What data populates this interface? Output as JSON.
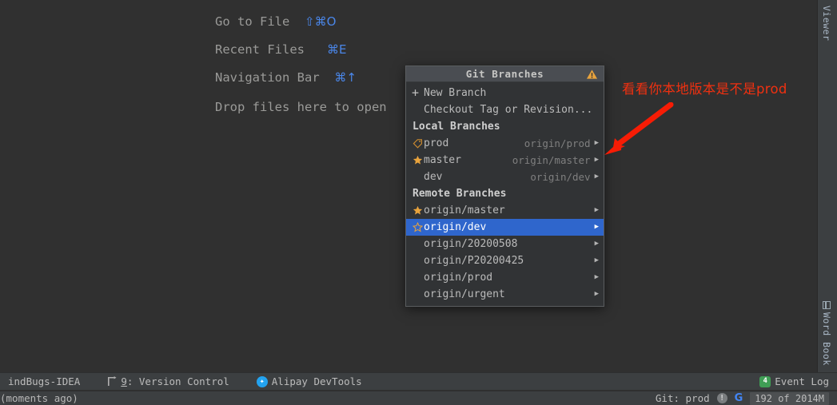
{
  "editor_hints": [
    {
      "label": "Go to File",
      "shortcut": "⇧⌘O"
    },
    {
      "label": "Recent Files",
      "shortcut": "⌘E"
    },
    {
      "label": "Navigation Bar",
      "shortcut": "⌘↑"
    },
    {
      "label": "Drop files here to open",
      "shortcut": ""
    }
  ],
  "right_strip": {
    "tabs": [
      {
        "label": "N Viewer",
        "icon": "json-viewer-icon"
      },
      {
        "label": "Word Book",
        "icon": "book-icon"
      }
    ]
  },
  "popup": {
    "title": "Git Branches",
    "warning_icon": "warning-triangle-icon",
    "actions": [
      {
        "label": "New Branch",
        "icon": "plus-icon"
      },
      {
        "label": "Checkout Tag or Revision...",
        "icon": ""
      }
    ],
    "local_section": "Local Branches",
    "local_branches": [
      {
        "name": "prod",
        "tracking": "origin/prod",
        "icon": "tag-icon",
        "selected": false,
        "arrow": "▶"
      },
      {
        "name": "master",
        "tracking": "origin/master",
        "icon": "star-filled-icon",
        "selected": false,
        "arrow": "▶"
      },
      {
        "name": "dev",
        "tracking": "origin/dev",
        "icon": "",
        "selected": false,
        "arrow": "▶"
      }
    ],
    "remote_section": "Remote Branches",
    "remote_branches": [
      {
        "name": "origin/master",
        "tracking": "",
        "icon": "star-filled-icon",
        "selected": false,
        "arrow": "▶"
      },
      {
        "name": "origin/dev",
        "tracking": "",
        "icon": "star-outline-icon",
        "selected": true,
        "arrow": "▶"
      },
      {
        "name": "origin/20200508",
        "tracking": "",
        "icon": "",
        "selected": false,
        "arrow": "▶"
      },
      {
        "name": "origin/P20200425",
        "tracking": "",
        "icon": "",
        "selected": false,
        "arrow": "▶"
      },
      {
        "name": "origin/prod",
        "tracking": "",
        "icon": "",
        "selected": false,
        "arrow": "▶"
      },
      {
        "name": "origin/urgent",
        "tracking": "",
        "icon": "",
        "selected": false,
        "arrow": "▶"
      }
    ]
  },
  "annotation": {
    "text": "看看你本地版本是不是prod",
    "color": "#f03010",
    "arrow_icon": "red-arrow-icon"
  },
  "status_bar": {
    "findbugs": "indBugs-IDEA",
    "version_control_num": "9",
    "version_control": ": Version Control",
    "alipay": "Alipay DevTools",
    "event_log": "Event Log",
    "event_log_badge": "4"
  },
  "info_bar": {
    "left": "(moments ago)",
    "git": "Git: prod",
    "memory": "192 of 2014M"
  }
}
